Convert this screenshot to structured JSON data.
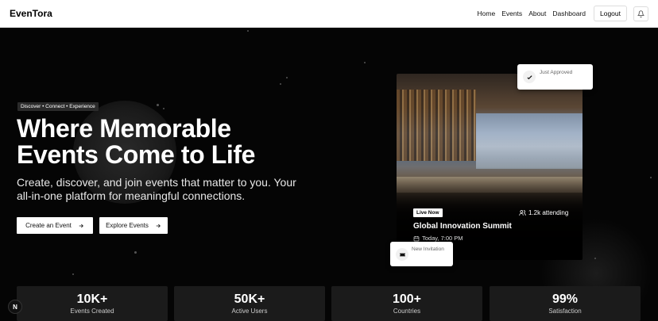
{
  "nav": {
    "logo": "EvenTora",
    "links": [
      "Home",
      "Events",
      "About",
      "Dashboard"
    ],
    "logout": "Logout"
  },
  "hero": {
    "badge": "Discover • Connect • Experience",
    "headline": "Where Memorable Events Come to Life",
    "subtext": "Create, discover, and join events that matter to you. Your all-in-one platform for meaningful connections.",
    "create_button": "Create an Event",
    "explore_button": "Explore Events"
  },
  "event_card": {
    "live_badge": "Live Now",
    "attending": "1.2k attending",
    "title": "Global Innovation Summit",
    "time": "Today, 7:00 PM"
  },
  "toasts": {
    "approved": "Just Approved",
    "invitation": "New Invitation"
  },
  "stats": [
    {
      "value": "10K+",
      "label": "Events Created"
    },
    {
      "value": "50K+",
      "label": "Active Users"
    },
    {
      "value": "100+",
      "label": "Countries"
    },
    {
      "value": "99%",
      "label": "Satisfaction"
    }
  ],
  "corner_badge": "N",
  "icons": {
    "bell": "bell-icon",
    "arrow": "arrow-right-icon",
    "check": "check-icon",
    "ticket": "ticket-icon",
    "users": "users-icon",
    "calendar": "calendar-icon"
  }
}
